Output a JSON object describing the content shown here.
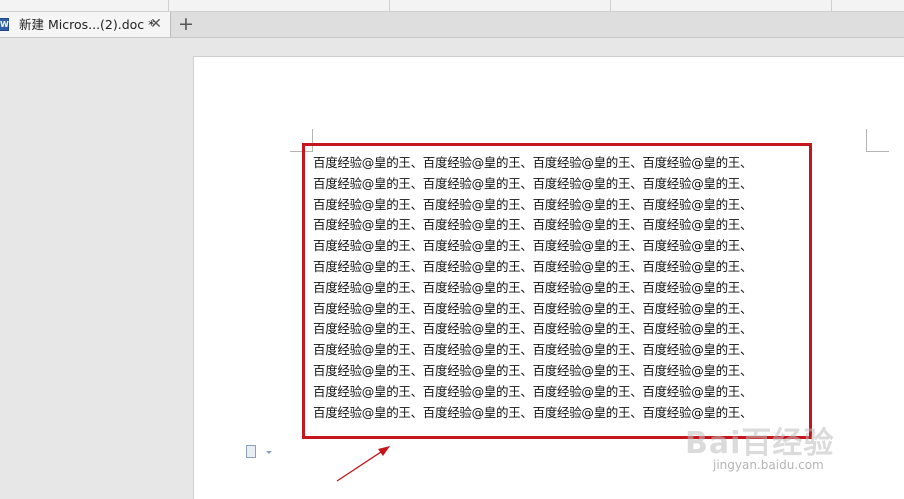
{
  "tabs": {
    "active_title": "新建 Micros...(2).doc *",
    "close_glyph": "✕",
    "new_tab_glyph": "+"
  },
  "document": {
    "lines": [
      "百度经验@皇的王、百度经验@皇的王、百度经验@皇的王、百度经验@皇的王、",
      "百度经验@皇的王、百度经验@皇的王、百度经验@皇的王、百度经验@皇的王、",
      "百度经验@皇的王、百度经验@皇的王、百度经验@皇的王、百度经验@皇的王、",
      "百度经验@皇的王、百度经验@皇的王、百度经验@皇的王、百度经验@皇的王、",
      "百度经验@皇的王、百度经验@皇的王、百度经验@皇的王、百度经验@皇的王、",
      "百度经验@皇的王、百度经验@皇的王、百度经验@皇的王、百度经验@皇的王、",
      "百度经验@皇的王、百度经验@皇的王、百度经验@皇的王、百度经验@皇的王、",
      "百度经验@皇的王、百度经验@皇的王、百度经验@皇的王、百度经验@皇的王、",
      "百度经验@皇的王、百度经验@皇的王、百度经验@皇的王、百度经验@皇的王、",
      "百度经验@皇的王、百度经验@皇的王、百度经验@皇的王、百度经验@皇的王、",
      "百度经验@皇的王、百度经验@皇的王、百度经验@皇的王、百度经验@皇的王、",
      "百度经验@皇的王、百度经验@皇的王、百度经验@皇的王、百度经验@皇的王、",
      "百度经验@皇的王、百度经验@皇的王、百度经验@皇的王、百度经验@皇的王、"
    ]
  },
  "annotation": {
    "highlight_color": "#c4161c",
    "arrow_color": "#c4161c"
  },
  "watermark": {
    "logo_text": "Bai百经验",
    "url": "jingyan.baidu.com"
  },
  "icons": {
    "tab_doc": "word-doc-icon",
    "paragraph_options": "paragraph-options-icon"
  }
}
